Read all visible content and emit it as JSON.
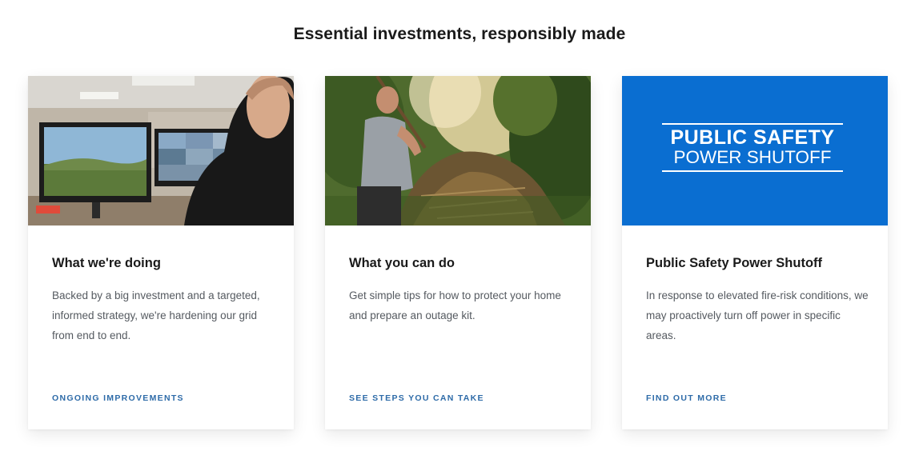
{
  "section": {
    "title": "Essential investments, responsibly made"
  },
  "cards": [
    {
      "image_alt": "Person monitoring camera feeds on computer screens",
      "title": "What we're doing",
      "description": "Backed by a big investment and a targeted, informed strategy, we're hardening our grid from end to end.",
      "link_label": "ONGOING IMPROVEMENTS"
    },
    {
      "image_alt": "Man clearing brush with a pitchfork",
      "title": "What you can do",
      "description": "Get simple tips for how to protect your home and prepare an outage kit.",
      "link_label": "SEE STEPS YOU CAN TAKE"
    },
    {
      "image_alt": "Public Safety Power Shutoff logo",
      "logo_line1": "PUBLIC SAFETY",
      "logo_line2": "POWER SHUTOFF",
      "title": "Public Safety Power Shutoff",
      "description": "In response to elevated fire-risk conditions, we may proactively turn off power in specific areas.",
      "link_label": "FIND OUT MORE"
    }
  ],
  "colors": {
    "link": "#2e6ba8",
    "psps_blue": "#0a6ed1",
    "text_dark": "#1a1a1a",
    "text_body": "#555a60"
  }
}
